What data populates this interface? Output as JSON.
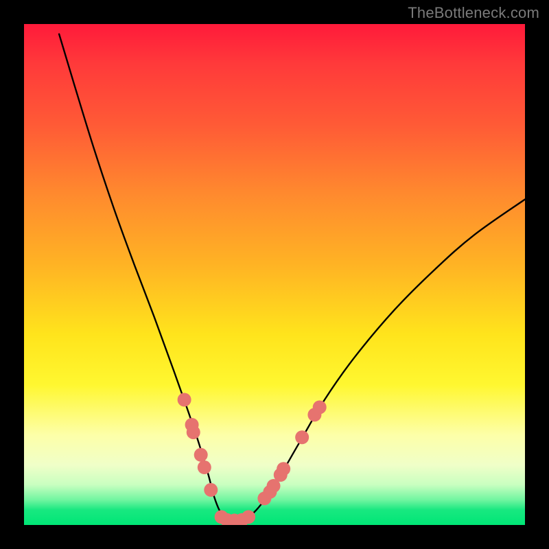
{
  "watermark": "TheBottleneck.com",
  "chart_data": {
    "type": "line",
    "title": "",
    "xlabel": "",
    "ylabel": "",
    "xlim": [
      0,
      100
    ],
    "ylim": [
      0,
      100
    ],
    "grid": false,
    "legend": false,
    "series": [
      {
        "name": "curve",
        "color": "#000000",
        "x": [
          7,
          10,
          14,
          18,
          22,
          26,
          30,
          33,
          35,
          36.8,
          38,
          39.3,
          40.8,
          43,
          46,
          50,
          55,
          60,
          66,
          74,
          82,
          90,
          100
        ],
        "y": [
          98,
          88,
          75,
          63,
          52,
          41.5,
          30.5,
          22,
          16,
          10,
          5.5,
          2.4,
          1.0,
          1.0,
          2.6,
          8,
          16.5,
          25,
          33.5,
          43,
          51,
          58,
          65
        ]
      }
    ],
    "markers": [
      {
        "name": "dots",
        "color": "#e6736f",
        "radius": 10,
        "points": [
          {
            "x": 32.0,
            "y": 25.0
          },
          {
            "x": 33.5,
            "y": 20.0
          },
          {
            "x": 33.8,
            "y": 18.5
          },
          {
            "x": 35.3,
            "y": 14.0
          },
          {
            "x": 36.0,
            "y": 11.5
          },
          {
            "x": 37.3,
            "y": 7.0
          },
          {
            "x": 39.4,
            "y": 1.6
          },
          {
            "x": 40.5,
            "y": 1.0
          },
          {
            "x": 42.0,
            "y": 0.9
          },
          {
            "x": 43.5,
            "y": 1.0
          },
          {
            "x": 44.8,
            "y": 1.6
          },
          {
            "x": 48.0,
            "y": 5.3
          },
          {
            "x": 49.1,
            "y": 6.6
          },
          {
            "x": 49.8,
            "y": 7.8
          },
          {
            "x": 51.2,
            "y": 10.0
          },
          {
            "x": 51.8,
            "y": 11.2
          },
          {
            "x": 55.5,
            "y": 17.5
          },
          {
            "x": 58.0,
            "y": 22.0
          },
          {
            "x": 59.0,
            "y": 23.5
          }
        ]
      }
    ]
  }
}
